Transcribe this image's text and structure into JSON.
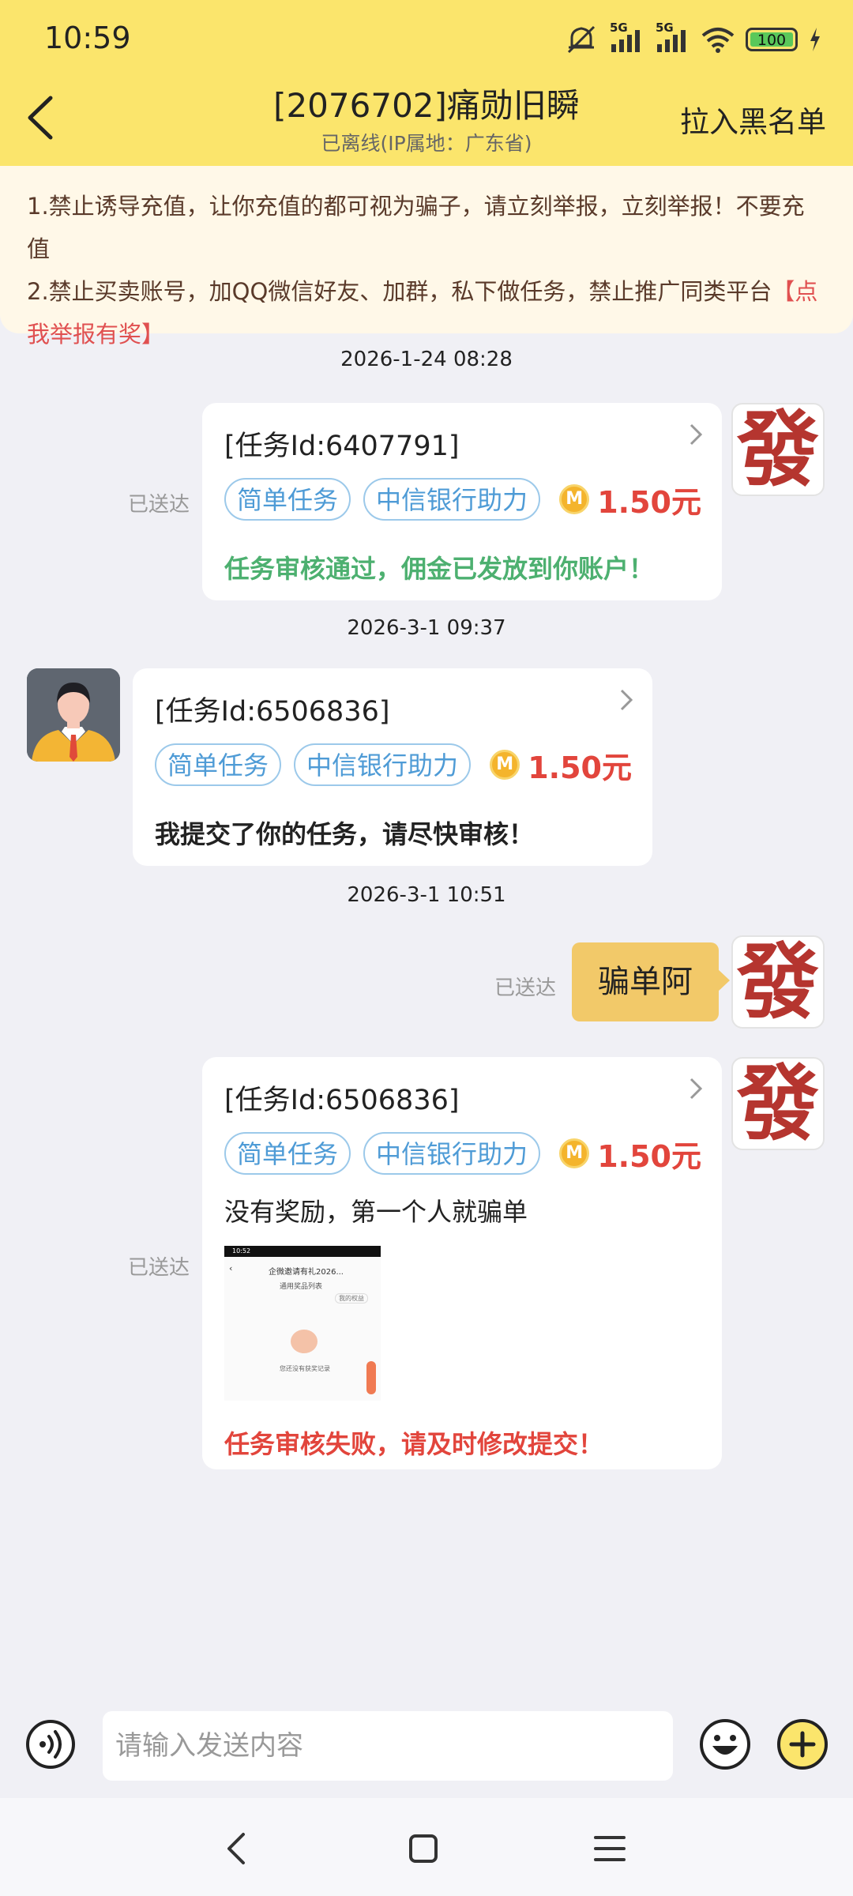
{
  "status_bar": {
    "time": "10:59",
    "network_1": "5G",
    "network_2": "5G",
    "battery": "100",
    "icons": [
      "mute-icon",
      "signal-icon",
      "wifi-icon",
      "battery-icon",
      "charging-icon"
    ]
  },
  "header": {
    "title": "[2076702]痛勋旧瞬",
    "subtitle": "已离线(IP属地：广东省)",
    "blacklist_label": "拉入黑名单",
    "background": "#fbe56c"
  },
  "notice": {
    "line1": "1.禁止诱导充值，让你充值的都可视为骗子，请立刻举报，立刻举报！不要充值",
    "line2": "2.禁止买卖账号，加QQ微信好友、加群，私下做任务，禁止推广同类平台",
    "report_link": "【点我举报有奖】"
  },
  "messages": {
    "m1": {
      "timestamp": "2026-1-24 08:28",
      "delivered": "已送达",
      "task_title": "[任务Id:6407791]",
      "tag1": "简单任务",
      "tag2": "中信银行助力",
      "coin": "M",
      "amount": "1.50元",
      "status": "任务审核通过，佣金已发放到你账户！",
      "avatar_char": "發"
    },
    "m2": {
      "timestamp": "2026-3-1 09:37",
      "task_title": "[任务Id:6506836]",
      "tag1": "简单任务",
      "tag2": "中信银行助力",
      "coin": "M",
      "amount": "1.50元",
      "status": "我提交了你的任务，请尽快审核！"
    },
    "m3": {
      "timestamp": "2026-3-1 10:51",
      "delivered": "已送达",
      "text": "骗单阿",
      "avatar_char": "發"
    },
    "m4": {
      "delivered": "已送达",
      "task_title": "[任务Id:6506836]",
      "tag1": "简单任务",
      "tag2": "中信银行助力",
      "coin": "M",
      "amount": "1.50元",
      "text": "没有奖励，第一个人就骗单",
      "thumb": {
        "time": "10:52",
        "title": "企微邀请有礼2026...",
        "subtitle": "通用奖品列表",
        "badge": "我的权益",
        "empty": "您还没有获奖记录"
      },
      "status": "任务审核失败，请及时修改提交！",
      "avatar_char": "發"
    }
  },
  "input": {
    "placeholder": "请输入发送内容"
  },
  "colors": {
    "accent_yellow": "#fbe56c",
    "tag_blue": "#4e9bd6",
    "amount_red": "#e2453c",
    "success_green": "#4db070",
    "bubble": "#f2c969"
  }
}
